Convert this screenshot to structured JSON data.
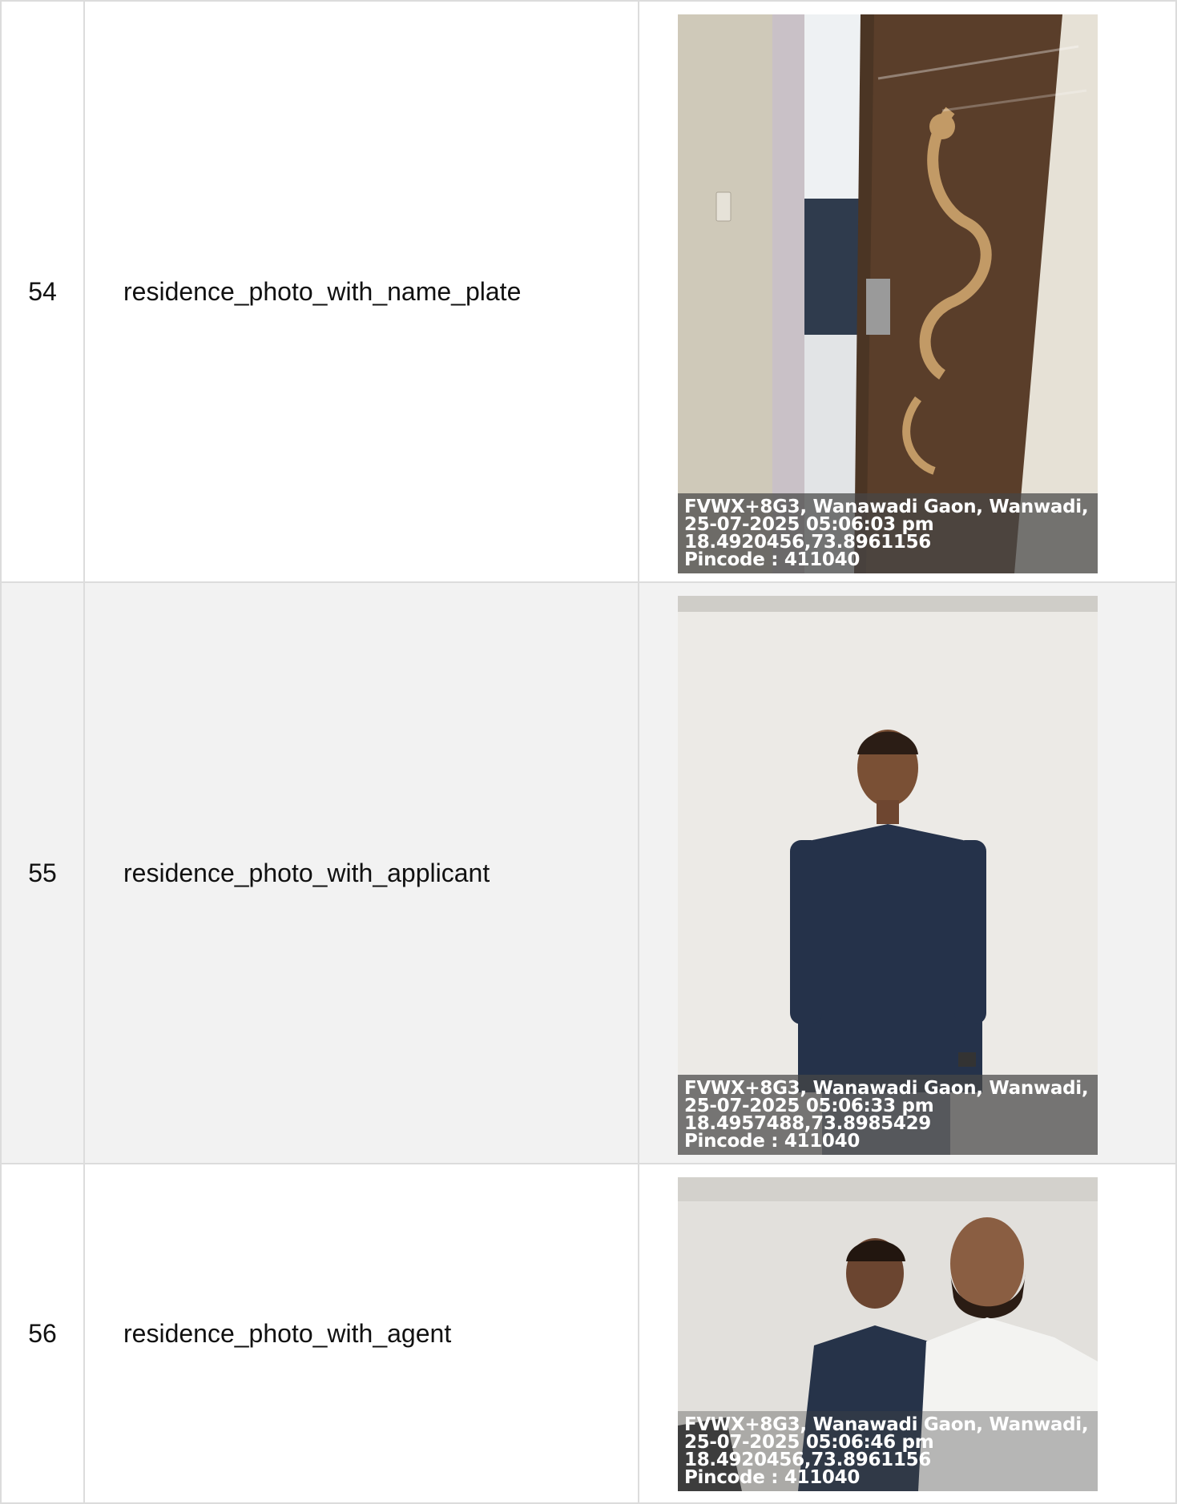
{
  "rows": [
    {
      "number": "54",
      "label": "residence_photo_with_name_plate",
      "stamp": {
        "address": "FVWX+8G3, Wanawadi Gaon, Wanwadi,",
        "datetime": "25-07-2025 05:06:03 pm",
        "coords": "18.4920456,73.8961156",
        "pincode": "Pincode : 411040"
      }
    },
    {
      "number": "55",
      "label": "residence_photo_with_applicant",
      "stamp": {
        "address": "FVWX+8G3, Wanawadi Gaon, Wanwadi,",
        "datetime": "25-07-2025 05:06:33 pm",
        "coords": "18.4957488,73.8985429",
        "pincode": "Pincode : 411040"
      }
    },
    {
      "number": "56",
      "label": "residence_photo_with_agent",
      "stamp": {
        "address": "FVWX+8G3, Wanawadi Gaon, Wanwadi,",
        "datetime": "25-07-2025 05:06:46 pm",
        "coords": "18.4920456,73.8961156",
        "pincode": "Pincode : 411040"
      }
    }
  ]
}
